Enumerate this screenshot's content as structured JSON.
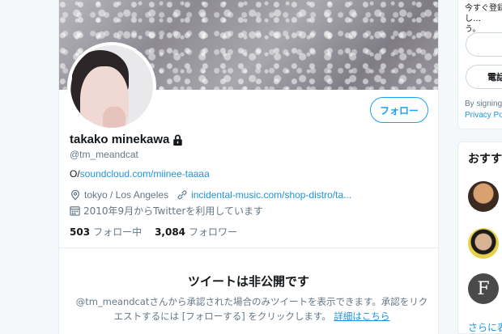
{
  "profile": {
    "display_name": "takako minekawa",
    "handle": "@tm_meandcat",
    "bio_prefix": "O/",
    "bio_link": "soundcloud.com/miinee-taaaa",
    "location": "tokyo / Los Angeles",
    "website": "incidental-music.com/shop-distro/ta...",
    "joined": "2010年9月からTwitterを利用しています",
    "following_count": "503",
    "following_label": "フォロー中",
    "followers_count": "3,084",
    "followers_label": "フォロワー",
    "follow_button_label": "フォロー"
  },
  "private_notice": {
    "title": "ツイートは非公開です",
    "message_line1": "@tm_meandcatさんから承認された場合のみツイートを表示できます。承認をリク",
    "message_line2": "エストするには [フォローする] をクリックします。",
    "details_link": "詳細はこちら"
  },
  "sidebar": {
    "signup_text": "今すぐ登録し…",
    "signup_text2": "う。",
    "phone_button": "電話",
    "terms_prefix": "By signing",
    "terms_link": "Privacy Po",
    "suggest_title": "おすす",
    "avatar3_letter": "F",
    "more_link": "さらに表"
  },
  "colors": {
    "accent": "#1da1f2",
    "link": "#1b95e0",
    "muted": "#657786"
  }
}
